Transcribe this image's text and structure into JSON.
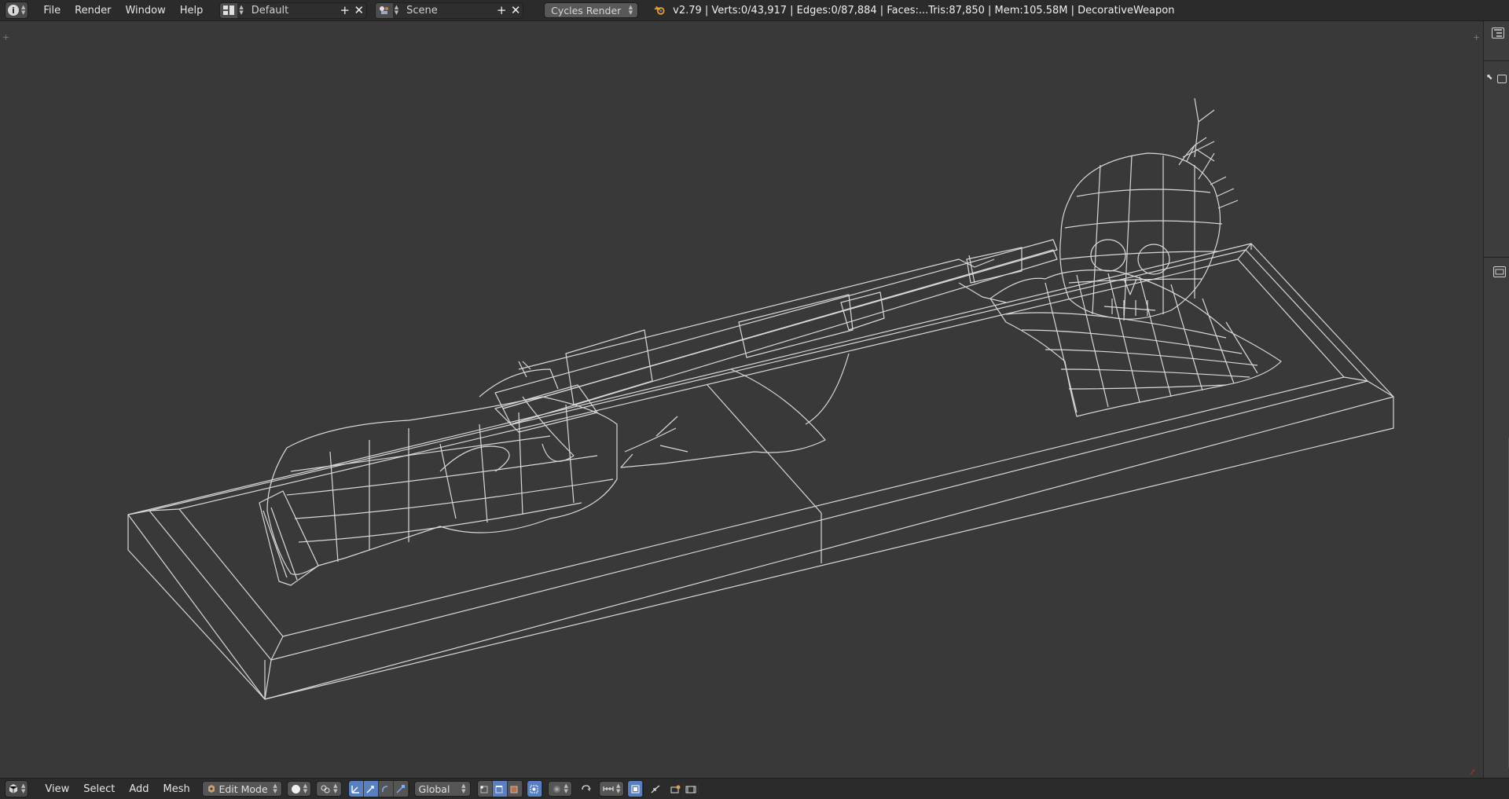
{
  "top_header": {
    "menus": [
      "File",
      "Render",
      "Window",
      "Help"
    ],
    "screen_layout": "Default",
    "scene": "Scene",
    "render_engine": "Cycles Render",
    "stats": "v2.79 | Verts:0/43,917 | Edges:0/87,884 | Faces:...Tris:87,850 | Mem:105.58M | DecorativeWeapon"
  },
  "viewport_header": {
    "menus": [
      "View",
      "Select",
      "Add",
      "Mesh"
    ],
    "mode": "Edit Mode",
    "transform_orientation": "Global"
  },
  "colors": {
    "header_bg": "#2b2b2b",
    "viewport_bg": "#393939",
    "wire": "#d8d8d8",
    "active_tool": "#5680c2"
  },
  "icons": {
    "editor_type_top": "info-icon",
    "editor_type_bottom": "view3d-icon",
    "viewport_shading": "solid-sphere-icon",
    "pivot": "pivot-icon",
    "manipulators": [
      "manipulator-toggle-icon",
      "translate-icon",
      "rotate-icon",
      "scale-icon"
    ],
    "select_modes": [
      "vertex-select-icon",
      "edge-select-icon",
      "face-select-icon"
    ],
    "limit_selection": "occlude-geometry-icon",
    "proportional": "proportional-edit-icon",
    "snap": [
      "snap-toggle-icon",
      "snap-element-icon"
    ],
    "render_tools": [
      "opengl-render-icon",
      "opengl-render-animation-icon"
    ]
  }
}
